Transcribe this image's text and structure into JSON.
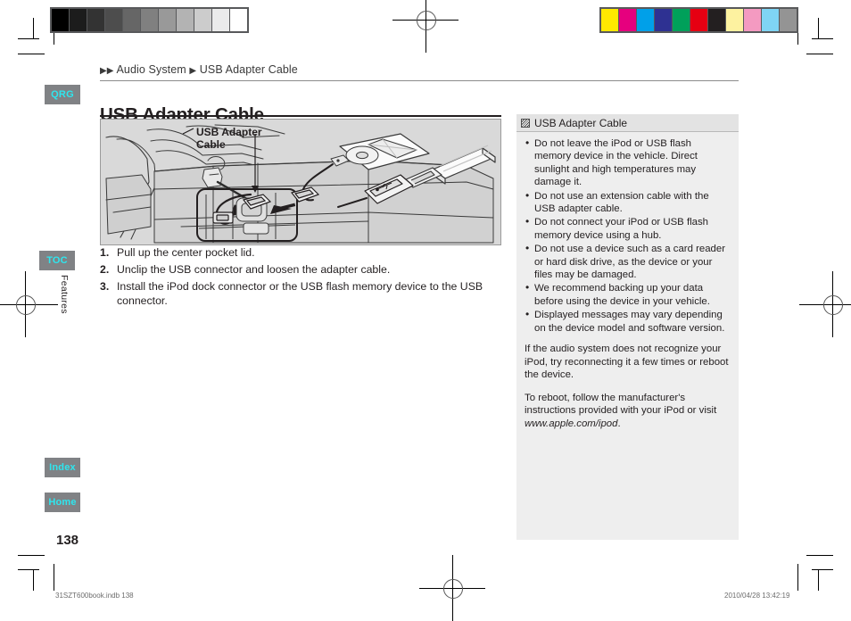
{
  "breadcrumb": {
    "arrow": "▶",
    "item1": "Audio System",
    "item2": "USB Adapter Cable"
  },
  "page_title": "USB Adapter Cable",
  "nav_tabs": [
    {
      "id": "qrg",
      "label": "QRG"
    },
    {
      "id": "toc",
      "label": "TOC"
    },
    {
      "id": "index",
      "label": "Index"
    },
    {
      "id": "home",
      "label": "Home"
    }
  ],
  "section_label": "Features",
  "figure": {
    "caption_line1": "USB Adapter",
    "caption_line2": "Cable"
  },
  "steps": [
    {
      "num": "1.",
      "text": "Pull up the center pocket lid."
    },
    {
      "num": "2.",
      "text": "Unclip the USB connector and loosen the adapter cable."
    },
    {
      "num": "3.",
      "text": "Install the iPod dock connector or the USB flash memory device to the USB connector."
    }
  ],
  "note": {
    "icon": "note-icon",
    "title": "USB Adapter Cable",
    "bullets": [
      "Do not leave the iPod or USB flash memory device in the vehicle. Direct sunlight and high temperatures may damage it.",
      "Do not use an extension cable with the USB adapter cable.",
      "Do not connect your iPod or USB flash memory device using a hub.",
      "Do not use a device such as a card reader or hard disk drive, as the device or your files may be damaged.",
      "We recommend backing up your data before using the device in your vehicle.",
      "Displayed messages may vary depending on the device model and software version."
    ],
    "paragraph1": "If the audio system does not recognize your iPod, try reconnecting it a few times or reboot the device.",
    "paragraph2_pre": "To reboot, follow the manufacturer's instructions provided with your iPod or visit ",
    "paragraph2_url": "www.apple.com/ipod",
    "paragraph2_post": "."
  },
  "page_number": "138",
  "footer": {
    "left": "31SZT600book.indb   138",
    "right": "2010/04/28   13:42:19"
  },
  "calibration": {
    "gray_bar": [
      "#000000",
      "#1c1c1c",
      "#333333",
      "#4d4d4d",
      "#666666",
      "#808080",
      "#999999",
      "#b3b3b3",
      "#cccccc",
      "#ebebeb",
      "#ffffff"
    ],
    "color_bar": [
      "#ffe900",
      "#e6007e",
      "#00a0e9",
      "#2e3192",
      "#00a05a",
      "#e60012",
      "#231f20",
      "#fdf2a0",
      "#f49ac1",
      "#7fd4f4",
      "#949494"
    ]
  }
}
